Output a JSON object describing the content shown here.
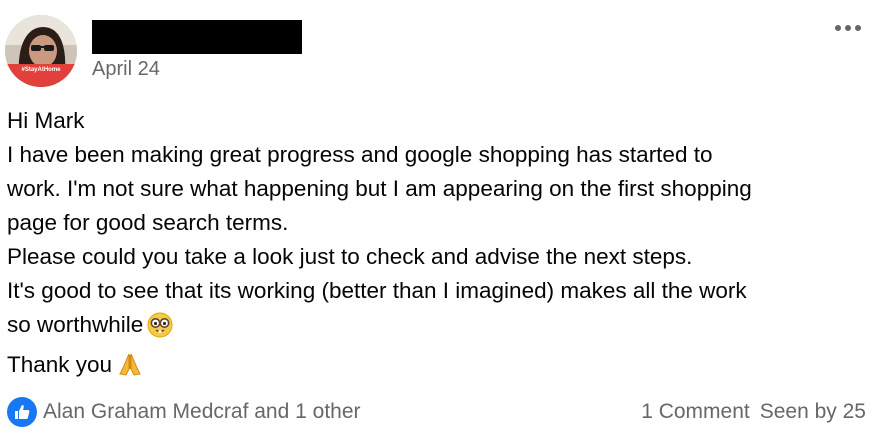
{
  "post": {
    "date": "April 24",
    "menu_icon": "more-horizontal-icon",
    "avatar_badge": "#StayAtHome",
    "lines": [
      "Hi Mark",
      "I have been making great progress and google shopping has started to",
      "work. I'm not sure what happening but I am appearing on the first shopping",
      "page for good search terms.",
      "Please could you take a look just to check and advise the next steps.",
      "It's good to see that its working (better than I imagined) makes all the work",
      "so worthwhile",
      "Thank you"
    ],
    "emojis": [
      "nerd-face-emoji",
      "folded-hands-emoji"
    ]
  },
  "footer": {
    "reaction_icon": "like-icon",
    "reactors": "Alan Graham Medcraf and 1 other",
    "comments": "1 Comment",
    "seen": "Seen by 25"
  },
  "colors": {
    "like_blue": "#1877f2",
    "secondary_text": "#65676b",
    "badge_red": "#e2403a"
  }
}
